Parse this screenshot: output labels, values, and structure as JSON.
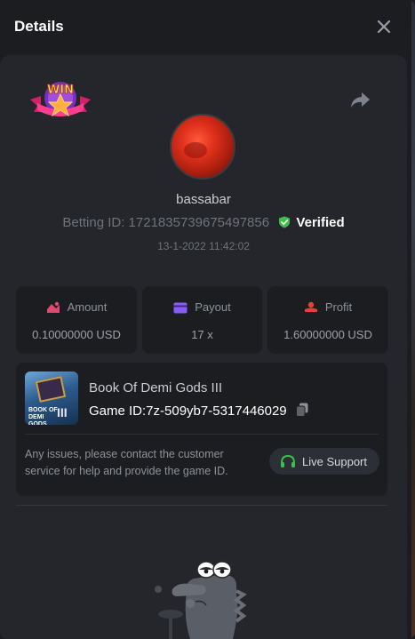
{
  "header": {
    "title": "Details",
    "close_icon": "close-icon"
  },
  "badge": {
    "text": "WIN",
    "icon": "win-badge-icon"
  },
  "share_icon": "share-icon",
  "user": {
    "username": "bassabar",
    "betting_label": "Betting ID: 1721835739675497856",
    "verified_label": "Verified",
    "datetime": "13-1-2022 11:42:02"
  },
  "stats": [
    {
      "label": "Amount",
      "value": "0.10000000 USD",
      "icon": "amount-icon",
      "color": "#e0486e"
    },
    {
      "label": "Payout",
      "value": "17 x",
      "icon": "payout-card-icon",
      "color": "#8a5cf6"
    },
    {
      "label": "Profit",
      "value": "1.60000000 USD",
      "icon": "profit-icon",
      "color": "#e5403a"
    }
  ],
  "game": {
    "name": "Book Of Demi Gods III",
    "game_id": "Game ID:7z-509yb7-5317446029",
    "thumb_text": "BOOK OF DEMI GODS",
    "thumb_numeral": "III"
  },
  "support": {
    "message": "Any issues, please contact the customer service for help and provide the game ID.",
    "button_label": "Live Support"
  },
  "colors": {
    "accent_green": "#3fbf4a",
    "background": "#1b1d21",
    "panel": "#24262b"
  }
}
